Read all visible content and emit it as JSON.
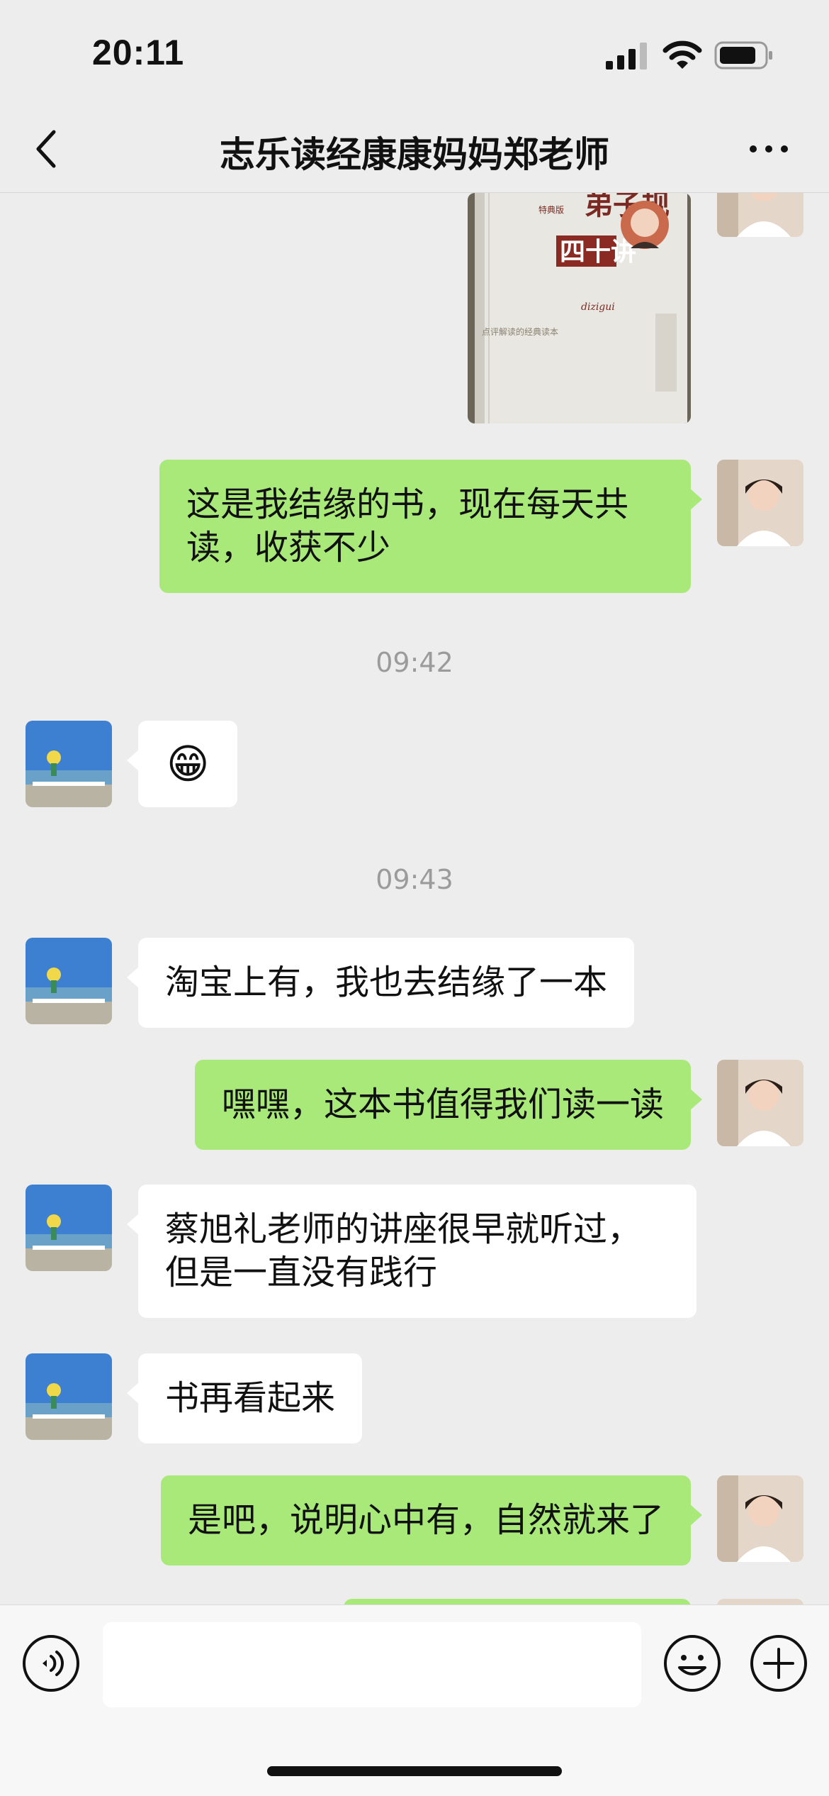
{
  "status_bar": {
    "time": "20:11"
  },
  "header": {
    "title": "志乐读经康康妈妈郑老师"
  },
  "messages": [
    {
      "text": "这是我结缘的书，现在每天共读，收获不少"
    },
    {
      "time": "09:42"
    },
    {
      "emoji": "😁"
    },
    {
      "time": "09:43"
    },
    {
      "text": "淘宝上有，我也去结缘了一本"
    },
    {
      "text": "嘿嘿，这本书值得我们读一读"
    },
    {
      "text": "蔡旭礼老师的讲座很早就听过，但是一直没有践行"
    },
    {
      "text": "书再看起来"
    },
    {
      "text": "是吧，说明心中有，自然就来了"
    }
  ],
  "book": {
    "title": "弟子规",
    "subtitle": "四十讲",
    "edition": "特典版",
    "tagline": "点评解读的经典读本",
    "pinyin": "dizigui"
  },
  "input": {
    "placeholder": ""
  },
  "colors": {
    "background": "#ededed",
    "outgoing_bubble": "#a9e97a",
    "incoming_bubble": "#ffffff",
    "timestamp": "#9b9b9b"
  },
  "icons": [
    "back-icon",
    "more-icon",
    "signal-icon",
    "wifi-icon",
    "battery-icon",
    "voice-icon",
    "emoji-icon",
    "plus-icon"
  ]
}
